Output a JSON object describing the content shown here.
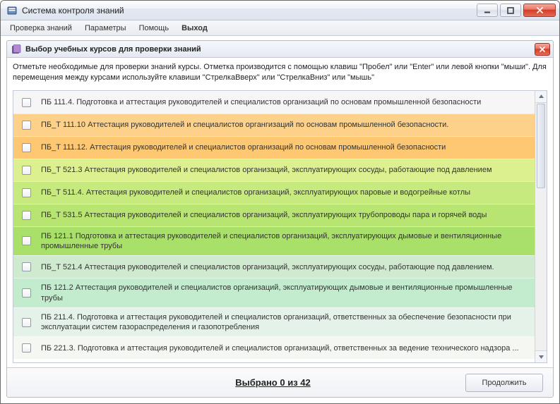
{
  "window": {
    "title": "Система контроля знаний"
  },
  "menu": {
    "items": [
      {
        "label": "Проверка знаний",
        "bold": false
      },
      {
        "label": "Параметры",
        "bold": false
      },
      {
        "label": "Помощь",
        "bold": false
      },
      {
        "label": "Выход",
        "bold": true
      }
    ]
  },
  "panel": {
    "title": "Выбор учебных курсов для проверки знаний",
    "instructions": "Отметьте необходимые для проверки знаний курсы. Отметка производится с помощью клавиш \"Пробел\" или \"Enter\" или левой кнопки \"мыши\". Для перемещения между курсами используйте клавиши \"СтрелкаВверх\" или \"СтрелкаВниз\" или \"мышь\""
  },
  "courses": [
    {
      "code": "ПБ 111.4.",
      "title": "Подготовка и аттестация руководителей и специалистов организаций по основам промышленной безопасности",
      "bg": "#f6f6f6"
    },
    {
      "code": "ПБ_Т 111.10",
      "title": "Аттестация руководителей и специалистов органгизаций по основам промышленной безопасности.",
      "bg": "#fdd18a"
    },
    {
      "code": "ПБ_Т 111.12.",
      "title": "Аттестация руководителей и специалистов организаций по основам промышленной безопасности",
      "bg": "#fec872"
    },
    {
      "code": "ПБ_Т 521.3",
      "title": "Аттестация руководителей и специалистов организаций, эксплуатирующих сосуды, работающие под давлением",
      "bg": "#ddf08f"
    },
    {
      "code": "ПБ_Т 511.4.",
      "title": "Аттестация руководителей и специалистов организаций, эксплуатирующих паровые и водогрейные котлы",
      "bg": "#c6ea7e"
    },
    {
      "code": "ПБ_Т 531.5",
      "title": "Аттестация руководителей и специалистов организаций, эксплуатирующих трубопроводы пара и горячей воды",
      "bg": "#b8e572"
    },
    {
      "code": "ПБ 121.1",
      "title": "Подготовка и аттестация руководителей и специалистов организаций, эксплуатирующих дымовые и вентиляционные промышленные трубы",
      "bg": "#a8e06a"
    },
    {
      "code": "ПБ_Т 521.4",
      "title": "Аттестация руководителей и специалистов организаций, эксплуатирующих сосуды, работающие под давлением.",
      "bg": "#d0ead0"
    },
    {
      "code": "ПБ 121.2",
      "title": "Аттестация руководителей и специалистов организаций, эксплуатирующих  дымовые и вентиляционные промышленные трубы",
      "bg": "#c3eccf"
    },
    {
      "code": "ПБ 211.4.",
      "title": "Подготовка и аттестация руководителей и специалистов организаций, ответственных за обеспечение безопасности при эксплуатации систем газораспределения и газопотребления",
      "bg": "#e4f2ea"
    },
    {
      "code": "ПБ 221.3.",
      "title": "Подготовка и аттестация руководителей и специалистов организаций, ответственных за ведение технического надзора ...",
      "bg": "#f4f7f2"
    }
  ],
  "footer": {
    "selected_text": "Выбрано 0 из 42",
    "continue_label": "Продолжить"
  }
}
